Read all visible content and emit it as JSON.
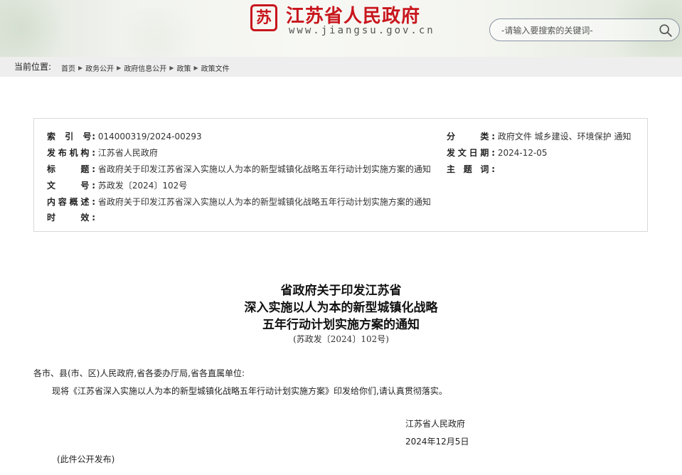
{
  "header": {
    "site_name": "江苏省人民政府",
    "site_url": "www.jiangsu.gov.cn",
    "search_placeholder": "-请输入要搜索的关键词-",
    "colors": {
      "brand_red": "#c8161d"
    }
  },
  "breadcrumb": {
    "label": "当前位置:",
    "items": [
      "首页",
      "政务公开",
      "政府信息公开",
      "政策",
      "政策文件"
    ]
  },
  "info": {
    "index_label": "索　引　号:",
    "index_value": "014000319/2024-00293",
    "category_label": "分　　类:",
    "category_value": "政府文件 城乡建设、环境保护 通知",
    "issuer_label": "发布机构:",
    "issuer_value": "江苏省人民政府",
    "date_label": "发文日期:",
    "date_value": "2024-12-05",
    "title_label": "标　　题:",
    "title_value": "省政府关于印发江苏省深入实施以人为本的新型城镇化战略五年行动计划实施方案的通知",
    "subject_label": "主 题 词:",
    "subject_value": "",
    "docno_label": "文　　号:",
    "docno_value": "苏政发〔2024〕102号",
    "summary_label": "内容概述:",
    "summary_value": "省政府关于印发江苏省深入实施以人为本的新型城镇化战略五年行动计划实施方案的通知",
    "validity_label": "时　　效:",
    "validity_value": ""
  },
  "document": {
    "title_lines": [
      "省政府关于印发江苏省",
      "深入实施以人为本的新型城镇化战略",
      "五年行动计划实施方案的通知"
    ],
    "number": "(苏政发〔2024〕102号)",
    "salutation": "各市、县(市、区)人民政府,省各委办厅局,省各直属单位:",
    "paragraph": "现将《江苏省深入实施以人为本的新型城镇化战略五年行动计划实施方案》印发给你们,请认真贯彻落实。",
    "signature_org": "江苏省人民政府",
    "signature_date": "2024年12月5日",
    "note": "(此件公开发布)"
  }
}
